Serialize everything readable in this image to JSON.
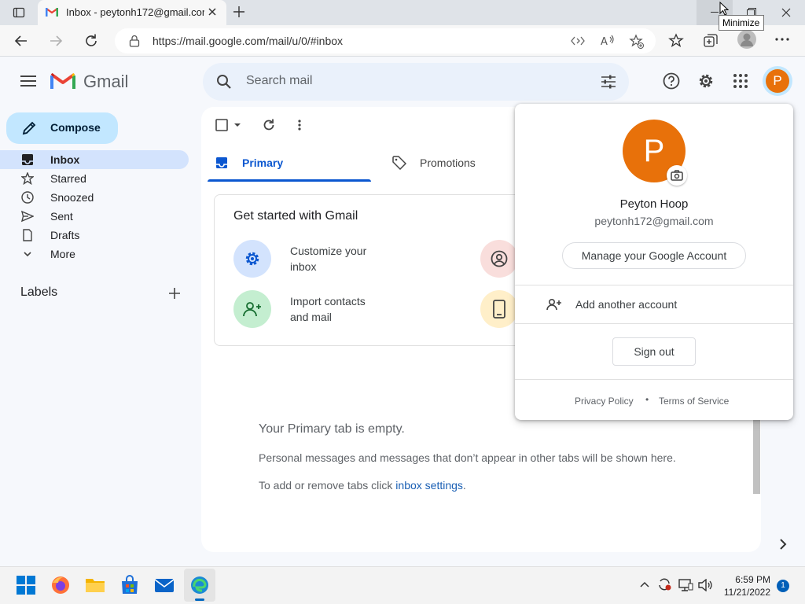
{
  "browser": {
    "tab_title": "Inbox - peytonh172@gmail.com",
    "url": "https://mail.google.com/mail/u/0/#inbox",
    "tooltip": "Minimize"
  },
  "gmail": {
    "logo_text": "Gmail",
    "search_placeholder": "Search mail",
    "avatar_letter": "P",
    "compose_label": "Compose",
    "nav": [
      "Inbox",
      "Starred",
      "Snoozed",
      "Sent",
      "Drafts",
      "More"
    ],
    "labels_heading": "Labels",
    "tabs": [
      "Primary",
      "Promotions"
    ],
    "get_started": {
      "title": "Get started with Gmail",
      "items": [
        {
          "line1": "Customize your",
          "line2": "inbox"
        },
        {
          "line1": "Import contacts",
          "line2": "and mail"
        }
      ]
    },
    "empty": {
      "title": "Your Primary tab is empty.",
      "line1": "Personal messages and messages that don’t appear in other tabs will be shown here.",
      "line2_prefix": "To add or remove tabs click ",
      "line2_link": "inbox settings",
      "line2_suffix": "."
    }
  },
  "account_popup": {
    "avatar_letter": "P",
    "name": "Peyton Hoop",
    "email": "peytonh172@gmail.com",
    "manage_label": "Manage your Google Account",
    "add_account_label": "Add another account",
    "sign_out_label": "Sign out",
    "privacy": "Privacy Policy",
    "separator": "•",
    "terms": "Terms of Service"
  },
  "taskbar": {
    "time": "6:59 PM",
    "date": "11/21/2022",
    "notifications": "1"
  },
  "colors": {
    "accent": "#0b57d0",
    "avatar": "#e8710a",
    "compose_bg": "#c2e7ff",
    "nav_active": "#d3e3fd"
  }
}
